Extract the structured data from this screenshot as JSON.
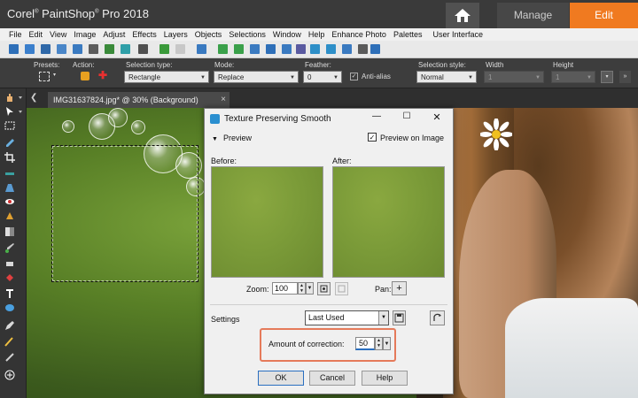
{
  "app": {
    "name": "Corel",
    "name_sup": "®",
    "product": "PaintShop",
    "product_sup": "®",
    "version": "Pro 2018",
    "tabs": {
      "manage": "Manage",
      "edit": "Edit"
    }
  },
  "menu": [
    "File",
    "Edit",
    "View",
    "Image",
    "Adjust",
    "Effects",
    "Layers",
    "Objects",
    "Selections",
    "Window",
    "Help",
    "Enhance Photo",
    "Palettes",
    "User Interface"
  ],
  "options": {
    "presets_label": "Presets:",
    "action_label": "Action:",
    "selection_type_label": "Selection type:",
    "selection_type_value": "Rectangle",
    "mode_label": "Mode:",
    "mode_value": "Replace",
    "feather_label": "Feather:",
    "feather_value": "0",
    "anti_alias_label": "Anti-alias",
    "anti_alias_check": "✓",
    "selection_style_label": "Selection style:",
    "selection_style_value": "Normal",
    "width_label": "Width",
    "width_value": "1",
    "height_label": "Height",
    "height_value": "1"
  },
  "document": {
    "tab_label": "IMG31637824.jpg* @  30% (Background)",
    "close_glyph": "×",
    "scroll_left_glyph": "❮"
  },
  "dialog": {
    "title": "Texture Preserving Smooth",
    "min_glyph": "—",
    "max_glyph": "☐",
    "close_glyph": "✕",
    "preview_toggle": "Preview",
    "preview_on_image_label": "Preview on Image",
    "preview_on_image_check": "✓",
    "before_label": "Before:",
    "after_label": "After:",
    "zoom_label": "Zoom:",
    "zoom_value": "100",
    "pan_label": "Pan:",
    "pan_glyph": "+",
    "settings_label": "Settings",
    "settings_value": "Last Used",
    "amount_label": "Amount of correction:",
    "amount_value": "50",
    "ok_label": "OK",
    "cancel_label": "Cancel",
    "help_label": "Help"
  },
  "colors": {
    "edit_tab": "#f07a20",
    "highlight": "#e57a5a",
    "accent_blue": "#2a6fc0"
  }
}
